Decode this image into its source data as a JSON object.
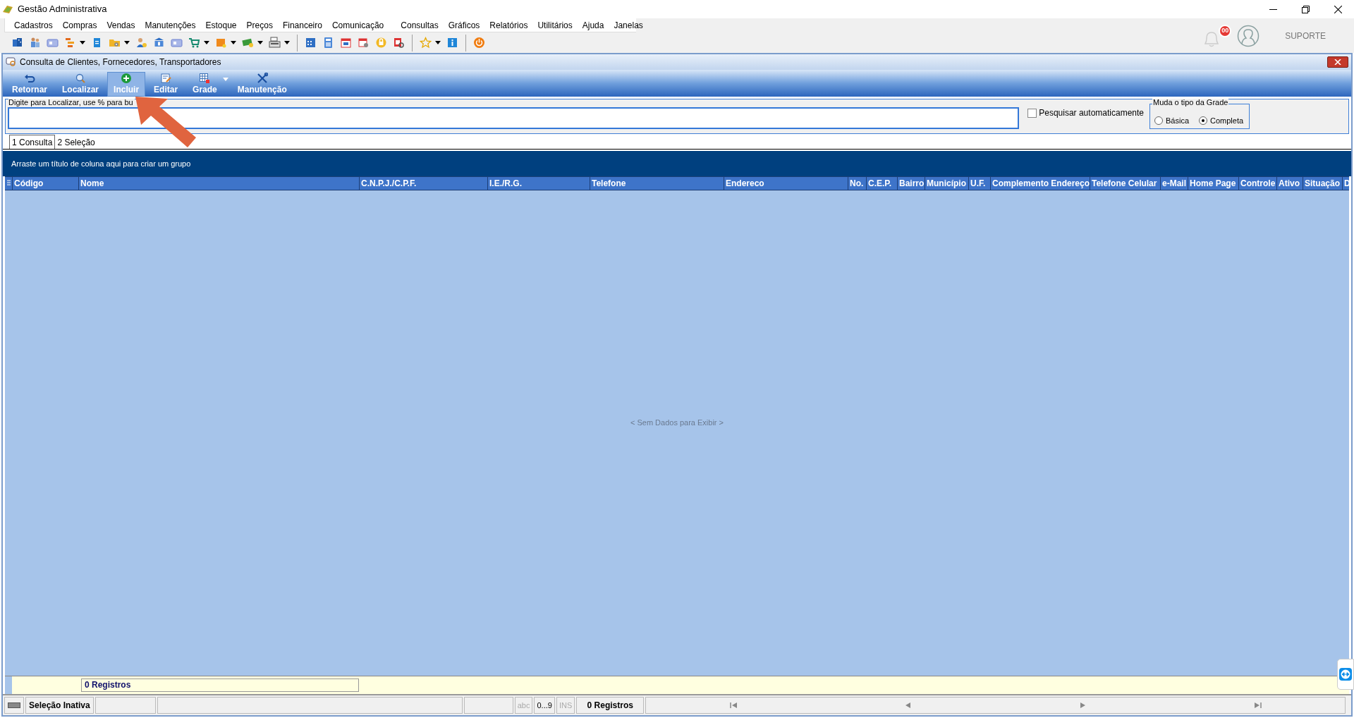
{
  "app_title": "Gestão Administrativa",
  "menu": [
    "Cadastros",
    "Compras",
    "Vendas",
    "Manutenções",
    "Estoque",
    "Preços",
    "Financeiro",
    "Comunicação",
    "Consultas",
    "Gráficos",
    "Relatórios",
    "Utilitários",
    "Ajuda",
    "Janelas"
  ],
  "toolbar_groups": [
    {
      "items": [
        {
          "has_menu": false
        },
        {
          "has_menu": false
        },
        {
          "has_menu": false
        },
        {
          "has_menu": true
        },
        {
          "has_menu": false
        },
        {
          "has_menu": true
        },
        {
          "has_menu": false
        },
        {
          "has_menu": false
        },
        {
          "has_menu": false
        },
        {
          "has_menu": true
        },
        {
          "has_menu": true
        },
        {
          "has_menu": true
        },
        {
          "has_menu": true
        }
      ]
    },
    {
      "items": [
        {
          "has_menu": false
        },
        {
          "has_menu": false
        },
        {
          "has_menu": false
        },
        {
          "has_menu": false
        },
        {
          "has_menu": false
        },
        {
          "has_menu": false
        }
      ]
    },
    {
      "items": [
        {
          "has_menu": true
        },
        {
          "has_menu": false
        }
      ]
    },
    {
      "items": [
        {
          "has_menu": false
        }
      ]
    }
  ],
  "notifications": {
    "badge": "00"
  },
  "support_label": "SUPORTE",
  "window": {
    "title": "Consulta de Clientes, Fornecedores, Transportadores"
  },
  "actions": [
    {
      "label": "Retornar",
      "highlighted": false,
      "has_menu": false
    },
    {
      "label": "Localizar",
      "highlighted": false,
      "has_menu": false
    },
    {
      "label": "Incluir",
      "highlighted": true,
      "has_menu": false
    },
    {
      "label": "Editar",
      "highlighted": false,
      "has_menu": false
    },
    {
      "label": "Grade",
      "highlighted": false,
      "has_menu": true
    },
    {
      "label": "Manutenção",
      "highlighted": false,
      "has_menu": false
    }
  ],
  "search": {
    "label": "Digite para Localizar, use % para bu"
  },
  "auto_search": {
    "label": "Pesquisar automaticamente",
    "checked": false
  },
  "grid_type": {
    "title": "Muda o tipo da Grade",
    "options": [
      {
        "label": "Básica",
        "selected": false
      },
      {
        "label": "Completa",
        "selected": true
      }
    ]
  },
  "tabs": [
    {
      "label": "1 Consulta",
      "selected": true
    },
    {
      "label": "2 Seleção",
      "selected": false
    }
  ],
  "group_panel": "Arraste um título de coluna aqui para criar um grupo",
  "table": {
    "columns": [
      "Código",
      "Nome",
      "C.N.P.J./C.P.F.",
      "I.E./R.G.",
      "Telefone",
      "Endereco",
      "No.",
      "C.E.P.",
      "Bairro",
      "Município",
      "U.F.",
      "Complemento Endereço",
      "Telefone Celular",
      "e-Mail",
      "Home Page",
      "Controle",
      "Ativo",
      "Situação",
      "D"
    ],
    "empty_message": "< Sem Dados para Exibir >",
    "footer_count": "0 Registros"
  },
  "status_bar": [
    {
      "kind": "keyboard"
    },
    {
      "kind": "label",
      "text": "Seleção Inativa"
    },
    {
      "kind": "empty"
    },
    {
      "kind": "empty"
    },
    {
      "kind": "empty"
    },
    {
      "kind": "indicator",
      "text": "abc",
      "disabled": true
    },
    {
      "kind": "indicator",
      "text": "0...9",
      "disabled": false
    },
    {
      "kind": "indicator",
      "text": "INS",
      "disabled": true
    },
    {
      "kind": "label",
      "text": "0 Registros"
    },
    {
      "kind": "navigator"
    }
  ]
}
